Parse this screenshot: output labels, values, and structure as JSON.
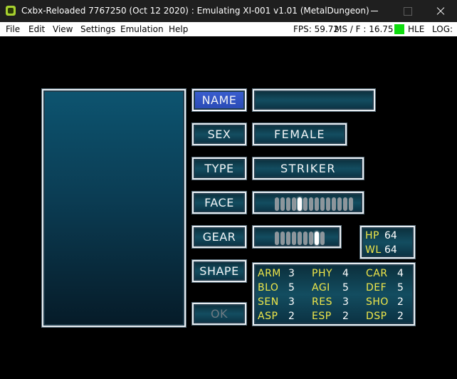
{
  "window": {
    "title": "Cxbx-Reloaded 7767250 (Oct 12 2020) : Emulating XI-001 v1.01 (MetalDungeon)",
    "accent": "#a7d12f"
  },
  "menu": {
    "items": [
      "File",
      "Edit",
      "View",
      "Settings",
      "Emulation",
      "Help"
    ]
  },
  "status": {
    "fps": "FPS: 59.72",
    "ms": "MS / F : 16.75",
    "mode": "HLE",
    "mode_color": "#0fdc0f",
    "log": "LOG:"
  },
  "game": {
    "buttons": {
      "name": "NAME",
      "sex": "SEX",
      "type": "TYPE",
      "face": "FACE",
      "gear": "GEAR",
      "shape": "SHAPE",
      "ok": "OK"
    },
    "fields": {
      "name": "",
      "sex": "FEMALE",
      "type": "STRIKER"
    },
    "face_slider": {
      "steps": 14,
      "selected": 4
    },
    "gear_slider": {
      "steps": 9,
      "selected": 7
    },
    "vitals": [
      {
        "key": "HP",
        "value": "64"
      },
      {
        "key": "WL",
        "value": "64"
      }
    ],
    "stats": [
      {
        "key": "ARM",
        "value": "3"
      },
      {
        "key": "PHY",
        "value": "4"
      },
      {
        "key": "CAR",
        "value": "4"
      },
      {
        "key": "BLO",
        "value": "5"
      },
      {
        "key": "AGI",
        "value": "5"
      },
      {
        "key": "DEF",
        "value": "5"
      },
      {
        "key": "SEN",
        "value": "3"
      },
      {
        "key": "RES",
        "value": "3"
      },
      {
        "key": "SHO",
        "value": "2"
      },
      {
        "key": "ASP",
        "value": "2"
      },
      {
        "key": "ESP",
        "value": "2"
      },
      {
        "key": "DSP",
        "value": "2"
      }
    ]
  }
}
